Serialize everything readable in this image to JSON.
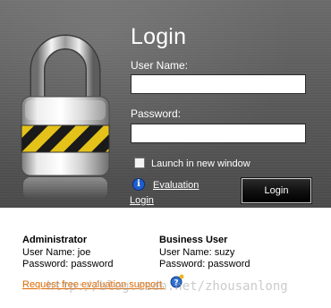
{
  "login": {
    "title": "Login",
    "username_label": "User Name:",
    "username_value": "",
    "password_label": "Password:",
    "password_value": "",
    "launch_new_window_label": "Launch in new window",
    "launch_new_window_checked": false,
    "evaluation_link": "Evaluation",
    "login_link": "Login",
    "login_button": "Login"
  },
  "accounts": [
    {
      "title": "Administrator",
      "username": "User Name: joe",
      "password": "Password: password"
    },
    {
      "title": "Business User",
      "username": "User Name: suzy",
      "password": "Password: password"
    }
  ],
  "request_link": "Request free evaluation support.",
  "watermark": "http://blog.csdn.net/zhousanlong",
  "colors": {
    "panel": "#5a5a5a",
    "link_orange": "#e06b00",
    "info_blue": "#1e5fd0"
  },
  "icons": {
    "lock": "padlock-icon",
    "info": "info-icon",
    "help": "help-icon"
  }
}
